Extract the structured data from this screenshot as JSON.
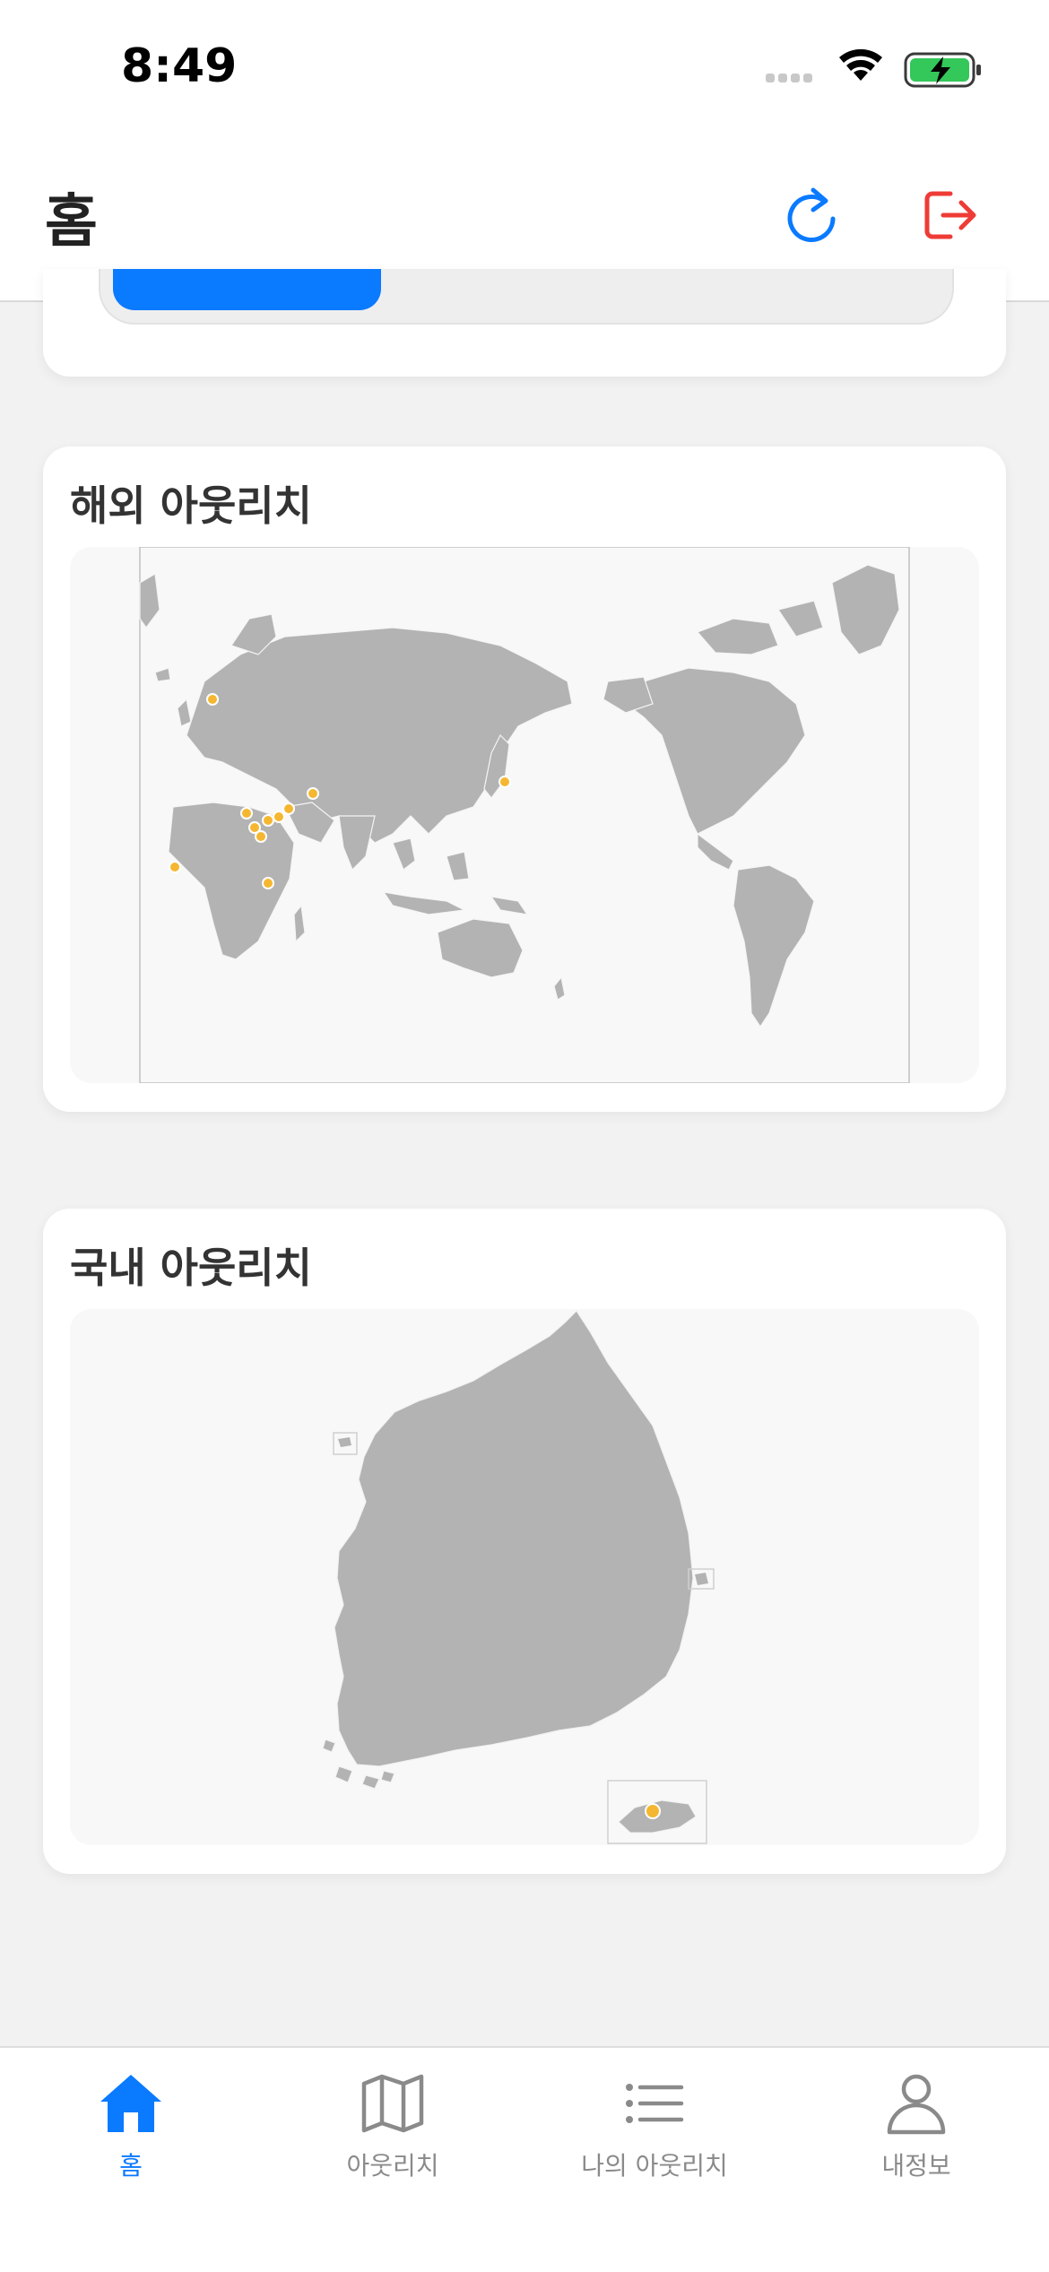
{
  "status_bar": {
    "time": "8:49"
  },
  "header": {
    "title": "홈",
    "refresh_icon": "refresh-icon",
    "logout_icon": "logout-icon"
  },
  "top_card": {
    "progress_fraction": 0.34
  },
  "overseas_card": {
    "title": "해외 아웃리치",
    "marker_color": "#f5b731",
    "markers": [
      "Kyrgyzstan",
      "Kenya",
      "India",
      "Myanmar",
      "Thailand",
      "Vietnam",
      "China",
      "Taiwan",
      "Indonesia",
      "Japan",
      "USA"
    ]
  },
  "domestic_card": {
    "title": "국내 아웃리치",
    "marker_color": "#f5b731",
    "markers": [
      "Jeju"
    ]
  },
  "tab_bar": {
    "accent": "#0a7aff",
    "items": [
      {
        "label": "홈",
        "icon": "home-icon",
        "active": true
      },
      {
        "label": "아웃리치",
        "icon": "map-icon",
        "active": false
      },
      {
        "label": "나의 아웃리치",
        "icon": "list-icon",
        "active": false
      },
      {
        "label": "내정보",
        "icon": "person-icon",
        "active": false
      }
    ]
  }
}
